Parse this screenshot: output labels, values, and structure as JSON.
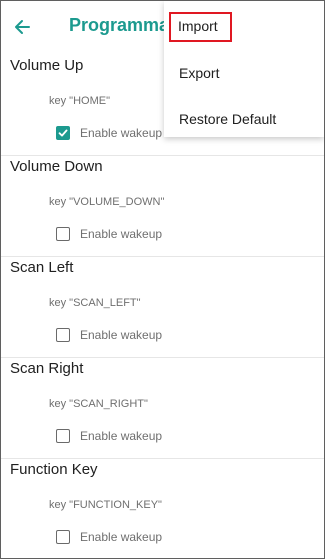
{
  "app_title": "Programmable Keys",
  "menu": {
    "items": [
      {
        "label": "Import"
      },
      {
        "label": "Export"
      },
      {
        "label": "Restore Default"
      }
    ]
  },
  "keys": [
    {
      "name": "Volume Up",
      "code": "key \"HOME\"",
      "wakeup_label": "Enable wakeup",
      "wakeup_enabled": true
    },
    {
      "name": "Volume Down",
      "code": "key \"VOLUME_DOWN\"",
      "wakeup_label": "Enable wakeup",
      "wakeup_enabled": false
    },
    {
      "name": "Scan Left",
      "code": "key \"SCAN_LEFT\"",
      "wakeup_label": "Enable wakeup",
      "wakeup_enabled": false
    },
    {
      "name": "Scan Right",
      "code": "key \"SCAN_RIGHT\"",
      "wakeup_label": "Enable wakeup",
      "wakeup_enabled": false
    },
    {
      "name": "Function Key",
      "code": "key \"FUNCTION_KEY\"",
      "wakeup_label": "Enable wakeup",
      "wakeup_enabled": false
    }
  ],
  "colors": {
    "accent": "#1c9a8f",
    "highlight_border": "#e01822"
  }
}
